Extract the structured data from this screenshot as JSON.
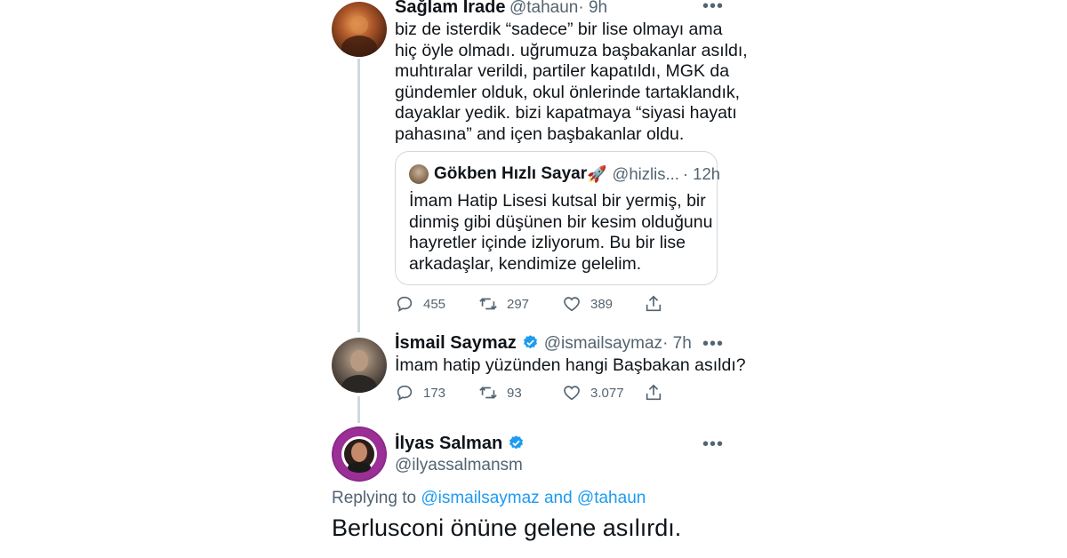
{
  "tweet1": {
    "name": "Sağlam İrade",
    "handle": "@tahaun",
    "time": "· 9h",
    "text": "biz de isterdik “sadece” bir lise olmayı ama\nhiç öyle olmadı. uğrumuza başbakanlar asıldı,\nmuhtıralar verildi, partiler kapatıldı, MGK da\ngündemler olduk, okul önlerinde tartaklandık,\ndayaklar yedik. bizi kapatmaya “siyasi hayatı\npahasına” and içen başbakanlar oldu.",
    "quote": {
      "name": "Gökben Hızlı Sayar",
      "emoji": "🚀",
      "handle": "@hizlis...",
      "time": "· 12h",
      "text": "İmam Hatip Lisesi kutsal bir yermiş, bir\ndinmiş gibi düşünen bir kesim olduğunu\nhayretler içinde izliyorum. Bu bir lise\narkadaşlar, kendimize gelelim."
    },
    "replies": "455",
    "retweets": "297",
    "likes": "389"
  },
  "tweet2": {
    "name": "İsmail Saymaz",
    "handle": "@ismailsaymaz",
    "time": "· 7h",
    "text": "İmam hatip yüzünden hangi Başbakan asıldı?",
    "replies": "173",
    "retweets": "93",
    "likes": "3.077"
  },
  "tweet3": {
    "name": "İlyas Salman",
    "handle": "@ilyassalmansm",
    "replying_prefix": "Replying to",
    "reply_to_1": "@ismailsaymaz",
    "reply_and": "and",
    "reply_to_2": "@tahaun",
    "text": "Berlusconi önüne gelene asılırdı."
  },
  "more_label": "•••",
  "colors": {
    "link": "#1d9bf0",
    "verified": "#1d9bf0",
    "secondary": "#536471",
    "line": "#cfd9de"
  }
}
